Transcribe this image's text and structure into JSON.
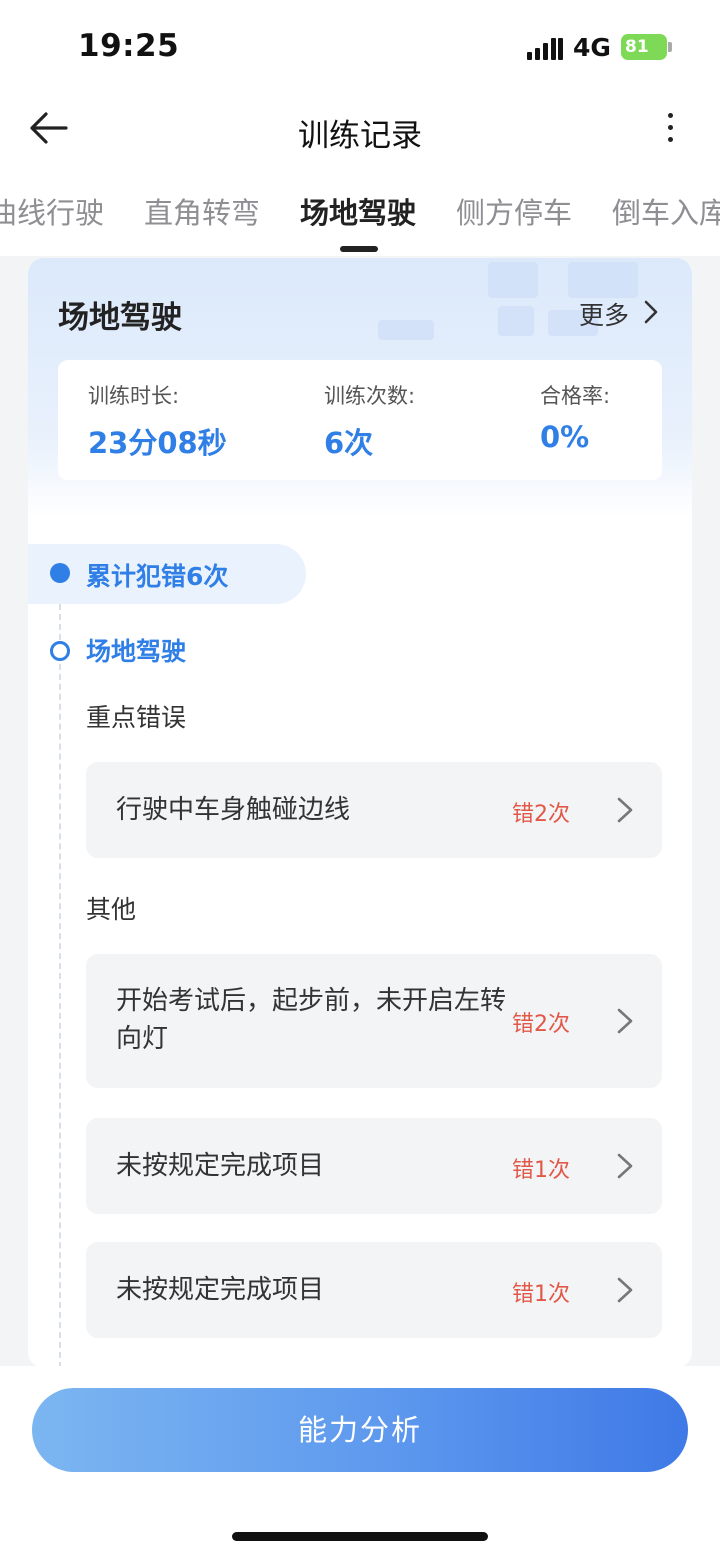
{
  "status_bar": {
    "time": "19:25",
    "network": "4G",
    "battery": "81"
  },
  "nav": {
    "title": "训练记录"
  },
  "tabs": [
    {
      "label": "曲线行驶",
      "active": false
    },
    {
      "label": "直角转弯",
      "active": false
    },
    {
      "label": "场地驾驶",
      "active": true
    },
    {
      "label": "侧方停车",
      "active": false
    },
    {
      "label": "倒车入库",
      "active": false
    }
  ],
  "card": {
    "title": "场地驾驶",
    "more_label": "更多",
    "stats": [
      {
        "label": "训练时长:",
        "value": "23分08秒"
      },
      {
        "label": "训练次数:",
        "value": "6次"
      },
      {
        "label": "合格率:",
        "value": "0%"
      }
    ]
  },
  "timeline": {
    "summary": "累计犯错6次",
    "section": "场地驾驶",
    "key_errors_label": "重点错误",
    "others_label": "其他",
    "key_errors": [
      {
        "text": "行驶中车身触碰边线",
        "count": "错2次"
      }
    ],
    "others": [
      {
        "text": "开始考试后，起步前，未开启左转向灯",
        "count": "错2次"
      },
      {
        "text": "未按规定完成项目",
        "count": "错1次"
      },
      {
        "text": "未按规定完成项目",
        "count": "错1次"
      }
    ]
  },
  "bottom": {
    "analyze_label": "能力分析"
  },
  "colors": {
    "accent": "#2f7fe6",
    "error": "#e25848",
    "battery": "#7ed957"
  }
}
